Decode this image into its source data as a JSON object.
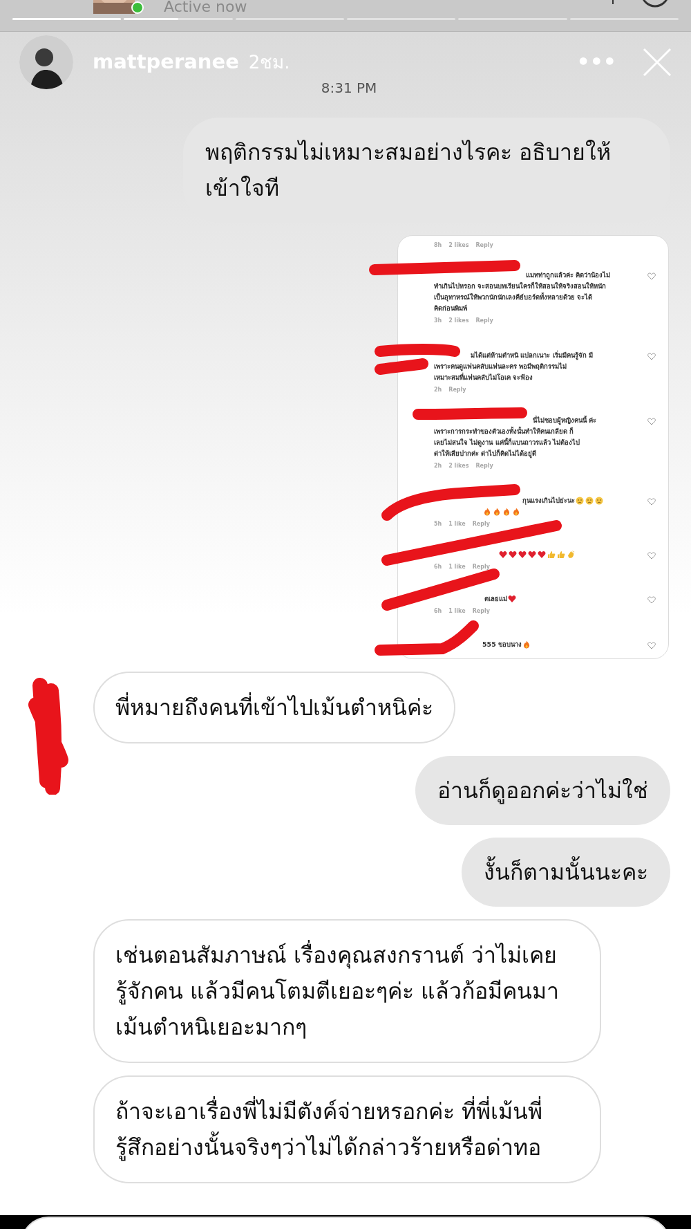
{
  "previous_header": {
    "status": "Active now",
    "online": true
  },
  "story_progress": [
    {
      "level": 1
    },
    {
      "level": 0.5
    }
  ],
  "story_header": {
    "username": "mattperanee",
    "age": "2ชม.",
    "more": "•••"
  },
  "timestamp": "8:31 PM",
  "messages": [
    {
      "kind": "outgoing",
      "text": "พฤติกรรมไม่เหมาะสมอย่างไรคะ อธิบายให้เข้าใจที"
    },
    {
      "top_meta": [
        "8h",
        "2 likes",
        "Reply"
      ],
      "comments": [
        {
          "lines": [
            {
              "text": "แมทท่าถูกแล้วค่ะ คิดว่าน้องไม่"
            },
            {
              "text": "ทำเกินไปหรอก จะสอนบทเรียนใครก็ให้สอนให้จริงสอนให้หนัก"
            },
            {
              "text": "เป็นอุทาหรณ์ให้พวกนักนักเลงคีย์บอร์ดทั้งหลายด้วย จะได้"
            },
            {
              "text": "คิดก่อนพิมพ์"
            }
          ],
          "meta": [
            "3h",
            "2 likes",
            "Reply"
          ]
        },
        {
          "lines": [
            {
              "text": "มได้แต่ห้ามตำหนิ แปลกเนาะ เริ่มมีคนรู้จัก มี"
            },
            {
              "text": "เพราะคนดูแฟนคลับแฟนละคร พอมีพฤติกรรมไม่"
            },
            {
              "text": "เหมาะสมที่แฟนคลับไม่โอเค จะฟ้อง"
            }
          ],
          "meta": [
            "2h",
            "Reply"
          ]
        },
        {
          "lines": [
            {
              "text": "นี่ไม่ชอบผู้หญิงคนนี้ ค่ะ"
            },
            {
              "text": "เพราะการกระทำของตัวเองทั้งนั้นทำให้คนเกลียด ก็"
            },
            {
              "text": "เลยไม่สนใจ ไม่ดูงาน แค่นี้ก็แบนถาวรแล้ว ไม่ต้องไป"
            },
            {
              "text": "ด่าให้เสียปากค่ะ ด่าไปก็คิดไม่ได้อยู่ดี"
            }
          ],
          "meta": [
            "2h",
            "2 likes",
            "Reply"
          ]
        },
        {
          "lines": [
            {
              "text": "กุนแรงเกินไปย่ะนะ",
              "emojis": [
                {
                  "kind": "sad"
                },
                {
                  "kind": "sad"
                },
                {
                  "kind": "sad"
                }
              ]
            },
            {
              "emojis": [
                {
                  "kind": "fire"
                },
                {
                  "kind": "fire"
                },
                {
                  "kind": "fire"
                },
                {
                  "kind": "fire"
                }
              ]
            }
          ],
          "meta": [
            "5h",
            "1 like",
            "Reply"
          ]
        },
        {
          "lines": [
            {
              "emojis": [
                {
                  "kind": "heart"
                },
                {
                  "kind": "heart"
                },
                {
                  "kind": "heart"
                },
                {
                  "kind": "heart"
                },
                {
                  "kind": "heart"
                },
                {
                  "kind": "thumb"
                },
                {
                  "kind": "thumb"
                },
                {
                  "kind": "clap"
                }
              ]
            }
          ],
          "meta": [
            "6h",
            "1 like",
            "Reply"
          ]
        },
        {
          "lines": [
            {
              "text": "ตเลยแม่",
              "emojis": [
                {
                  "kind": "heart"
                }
              ]
            }
          ],
          "meta": [
            "6h",
            "1 like",
            "Reply"
          ]
        },
        {
          "lines": [
            {
              "text": "555 ขอบนาง",
              "emojis": [
                {
                  "kind": "fire"
                }
              ]
            }
          ]
        }
      ]
    },
    {
      "kind": "incoming",
      "text": "พี่หมายถึงคนที่เข้าไปเม้นตำหนิค่ะ"
    },
    {
      "kind": "outgoing",
      "text": "อ่านก็ดูออกค่ะว่าไม่ใช่"
    },
    {
      "kind": "outgoing",
      "text": "งั้นก็ตามนั้นนะคะ"
    },
    {
      "kind": "incoming",
      "text": "เช่นตอนสัมภาษณ์ เรื่องคุณสงกรานต์ ว่าไม่เคยรู้จักคน แล้วมีคนโตมตีเยอะๆค่ะ แล้วก้อมีคนมาเม้นตำหนิเยอะมากๆ"
    },
    {
      "kind": "incoming",
      "text": "ถ้าจะเอาเรื่องพี่ไม่มีตังค์จ่ายหรอกค่ะ ที่พี่เม้นพี่รู้สึกอย่างนั้นจริงๆว่าไม่ได้กล่าวร้ายหรือด่าทอ"
    }
  ]
}
